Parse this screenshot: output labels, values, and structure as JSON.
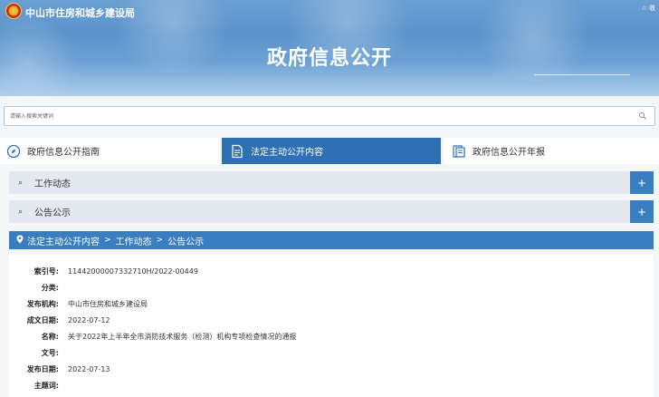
{
  "header": {
    "site_name": "中山市住房和城乡建设局",
    "top_links": "☆ 收",
    "banner_title": "政府信息公开"
  },
  "search": {
    "placeholder": "请输入搜索关键词"
  },
  "category_tabs": [
    {
      "label": "政府信息公开指南",
      "icon": "compass-icon",
      "active": false
    },
    {
      "label": "法定主动公开内容",
      "icon": "document-icon",
      "active": true
    },
    {
      "label": "政府信息公开年报",
      "icon": "report-icon",
      "active": false
    }
  ],
  "accordion": [
    {
      "label": "工作动态",
      "toggle": "+"
    },
    {
      "label": "公告公示",
      "toggle": "+"
    }
  ],
  "breadcrumb": {
    "items": [
      "法定主动公开内容",
      "工作动态",
      "公告公示"
    ],
    "separator": ">"
  },
  "info": [
    {
      "key": "索引号:",
      "value": "11442000007332710H/2022-00449"
    },
    {
      "key": "分类:",
      "value": ""
    },
    {
      "key": "发布机构:",
      "value": "中山市住房和城乡建设局"
    },
    {
      "key": "成文日期:",
      "value": "2022-07-12"
    },
    {
      "key": "名称:",
      "value": "关于2022年上半年全市消防技术服务（检测）机构专项检查情况的通报"
    },
    {
      "key": "文号:",
      "value": ""
    },
    {
      "key": "发布日期:",
      "value": "2022-07-13"
    },
    {
      "key": "主题词:",
      "value": ""
    }
  ],
  "colors": {
    "primary": "#2f6fb3",
    "accent": "#3a7ec2",
    "row_bg": "#e3e9ef"
  }
}
